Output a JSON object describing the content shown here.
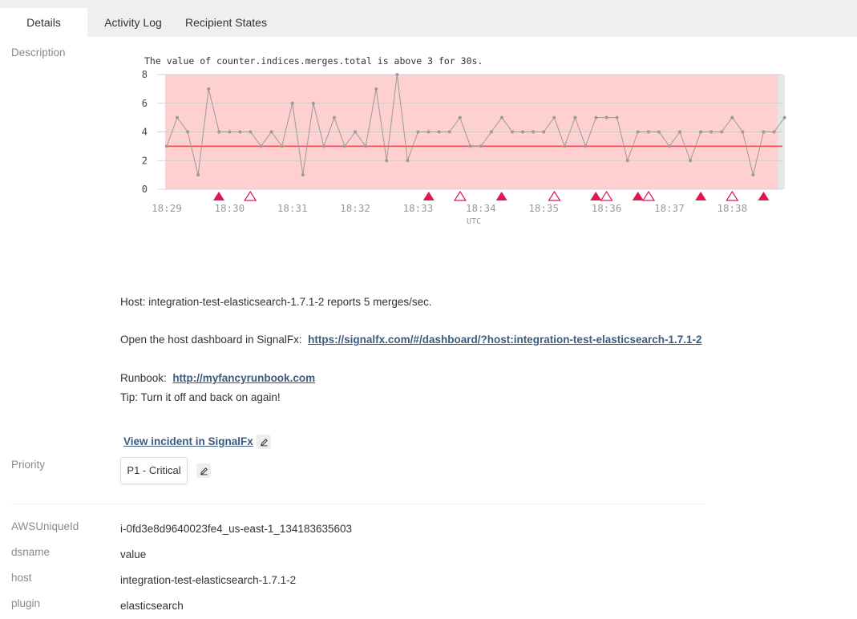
{
  "tabs": [
    {
      "label": "Details",
      "active": true
    },
    {
      "label": "Activity Log",
      "active": false
    },
    {
      "label": "Recipient States",
      "active": false
    }
  ],
  "labels": {
    "description": "Description",
    "priority": "Priority"
  },
  "description": {
    "host_line": "Host: integration-test-elasticsearch-1.7.1-2 reports 5 merges/sec.",
    "dashboard_prefix": "Open the host dashboard in SignalFx:",
    "dashboard_link": "https://signalfx.com/#/dashboard/?host:integration-test-elasticsearch-1.7.1-2",
    "runbook_prefix": "Runbook:",
    "runbook_link": "http://myfancyrunbook.com",
    "tip": "Tip: Turn it off and back on again!",
    "view_incident": "View incident in SignalFx"
  },
  "priority": {
    "value": "P1 - Critical"
  },
  "properties": [
    {
      "key": "AWSUniqueId",
      "value": "i-0fd3e8d9640023fe4_us-east-1_134183635603"
    },
    {
      "key": "dsname",
      "value": "value"
    },
    {
      "key": "host",
      "value": "integration-test-elasticsearch-1.7.1-2"
    },
    {
      "key": "plugin",
      "value": "elasticsearch"
    }
  ],
  "colors": {
    "accent": "#3d5a80",
    "threshold": "#e8454f",
    "band": "#ffd0d0",
    "marker": "#e0174f",
    "line": "#9a9a9a"
  },
  "chart_data": {
    "type": "line",
    "title": "The value of counter.indices.merges.total is above 3 for 30s.",
    "xlabel": "UTC",
    "ylabel": "",
    "ylim": [
      0,
      8
    ],
    "yticks": [
      0,
      2,
      4,
      6,
      8
    ],
    "xticks": [
      "18:29",
      "18:30",
      "18:31",
      "18:32",
      "18:33",
      "18:34",
      "18:35",
      "18:36",
      "18:37",
      "18:38"
    ],
    "xlim_minutes": [
      28.975,
      38.8
    ],
    "threshold": 3,
    "grid": true,
    "interval_seconds": 10,
    "start_label": "18:29",
    "values": [
      3,
      5,
      4,
      1,
      7,
      4,
      4,
      4,
      4,
      3,
      4,
      3,
      6,
      1,
      6,
      3,
      5,
      3,
      4,
      3,
      7,
      2,
      8,
      2,
      4,
      4,
      4,
      4,
      5,
      3,
      3,
      4,
      5,
      4,
      4,
      4,
      4,
      5,
      3,
      5,
      3,
      5,
      5,
      5,
      2,
      4,
      4,
      4,
      3,
      4,
      2,
      4,
      4,
      4,
      5,
      4,
      1,
      4,
      4,
      5
    ],
    "markers": [
      {
        "minute": 29.83,
        "kind": "triggered"
      },
      {
        "minute": 30.33,
        "kind": "cleared"
      },
      {
        "minute": 33.17,
        "kind": "triggered"
      },
      {
        "minute": 33.67,
        "kind": "cleared"
      },
      {
        "minute": 34.33,
        "kind": "triggered"
      },
      {
        "minute": 35.17,
        "kind": "cleared"
      },
      {
        "minute": 35.83,
        "kind": "triggered"
      },
      {
        "minute": 36.0,
        "kind": "cleared"
      },
      {
        "minute": 36.5,
        "kind": "triggered"
      },
      {
        "minute": 36.67,
        "kind": "cleared"
      },
      {
        "minute": 37.5,
        "kind": "triggered"
      },
      {
        "minute": 38.0,
        "kind": "cleared"
      },
      {
        "minute": 38.5,
        "kind": "triggered"
      }
    ]
  }
}
